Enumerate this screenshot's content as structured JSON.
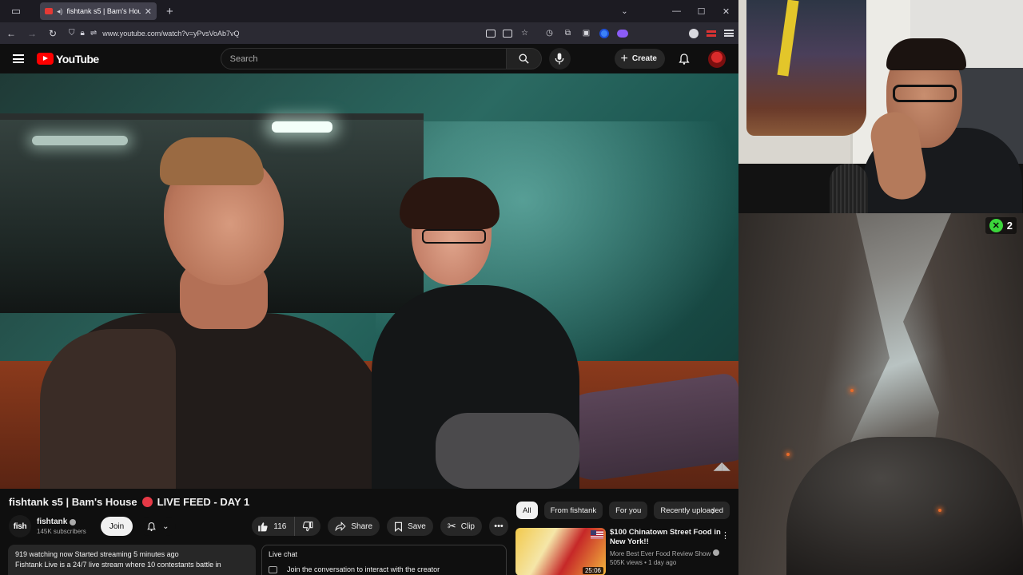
{
  "browser": {
    "tab_title": "fishtank s5 | Bam's House",
    "url": "www.youtube.com/watch?v=yPvsVoAb7vQ"
  },
  "youtube": {
    "logo_text": "YouTube",
    "search_placeholder": "Search",
    "create_label": "Create"
  },
  "video": {
    "title": "fishtank s5 | Bam's House",
    "title_suffix": "LIVE FEED - DAY 1",
    "channel_name": "fishtank",
    "channel_avatar_text": "fish",
    "subscribers": "145K subscribers",
    "join_label": "Join",
    "likes": "116",
    "share_label": "Share",
    "save_label": "Save",
    "clip_label": "Clip",
    "description_meta": "919 watching now  Started streaming 5 minutes ago",
    "description_text": "Fishtank Live is a 24/7 live stream where 10 contestants battle in"
  },
  "live_chat": {
    "header": "Live chat",
    "join_prompt": "Join the conversation to interact with the creator"
  },
  "chips": [
    "All",
    "From fishtank",
    "For you",
    "Recently uploaded"
  ],
  "recommendation": {
    "title": "$100 Chinatown Street Food in New York!!",
    "channel": "More Best Ever Food Review Show",
    "views": "505K views • 1 day ago",
    "duration": "25:06"
  },
  "game_overlay": {
    "counter": "2"
  }
}
